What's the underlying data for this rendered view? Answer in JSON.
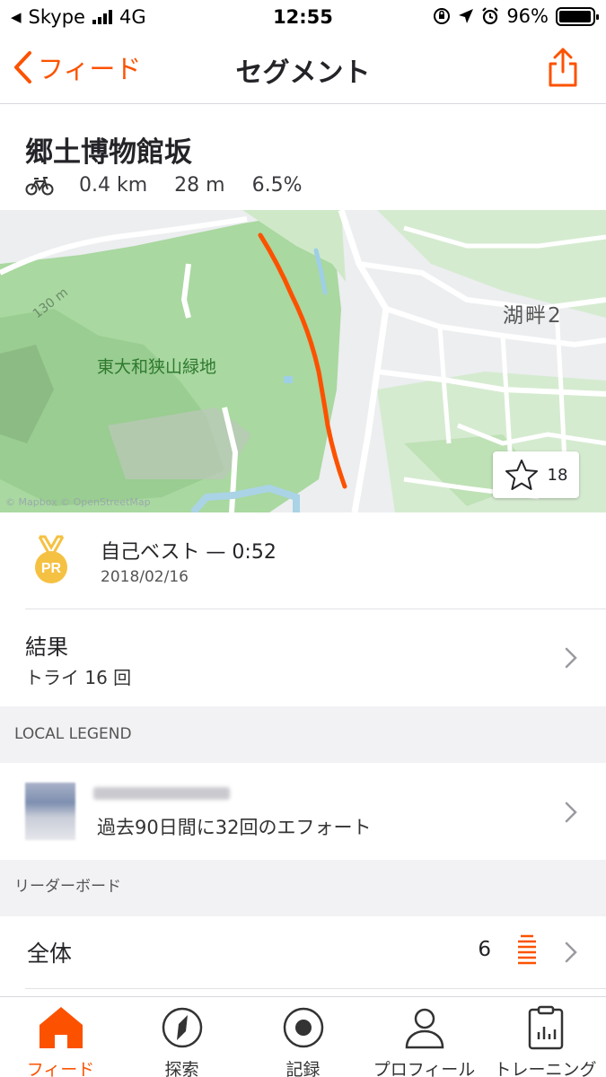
{
  "status_bar": {
    "carrier": "Skype",
    "network": "4G",
    "time": "12:55",
    "battery": "96%",
    "battery_level": 0.96
  },
  "nav": {
    "back_label": "フィード",
    "title": "セグメント",
    "share_icon": "share-icon"
  },
  "segment": {
    "name": "郷土博物館坂",
    "activity_icon": "bike-icon",
    "distance": "0.4 km",
    "elevation": "28 m",
    "grade": "6.5%"
  },
  "map": {
    "park_label": "東大和狭山緑地",
    "area_label": "湖畔2",
    "contour_label": "130 m",
    "attribution": "© Mapbox © OpenStreetMap",
    "star_count": "18",
    "route_color": "#fc5200"
  },
  "pr": {
    "title": "自己ベスト — 0:52",
    "date": "2018/02/16",
    "badge": "PR"
  },
  "results": {
    "title": "結果",
    "subtitle": "トライ 16 回"
  },
  "local_legend": {
    "section_title": "LOCAL LEGEND",
    "efforts": "過去90日間に32回のエフォート"
  },
  "leaderboard": {
    "section_title": "リーダーボード",
    "row_title": "全体",
    "rank": "6"
  },
  "tabs": [
    {
      "label": "フィード",
      "icon": "home-icon",
      "active": true
    },
    {
      "label": "探索",
      "icon": "compass-icon",
      "active": false
    },
    {
      "label": "記録",
      "icon": "record-icon",
      "active": false
    },
    {
      "label": "プロフィール",
      "icon": "profile-icon",
      "active": false
    },
    {
      "label": "トレーニング",
      "icon": "clipboard-chart-icon",
      "active": false
    }
  ],
  "colors": {
    "accent": "#fc5200",
    "medal": "#f5c142"
  }
}
